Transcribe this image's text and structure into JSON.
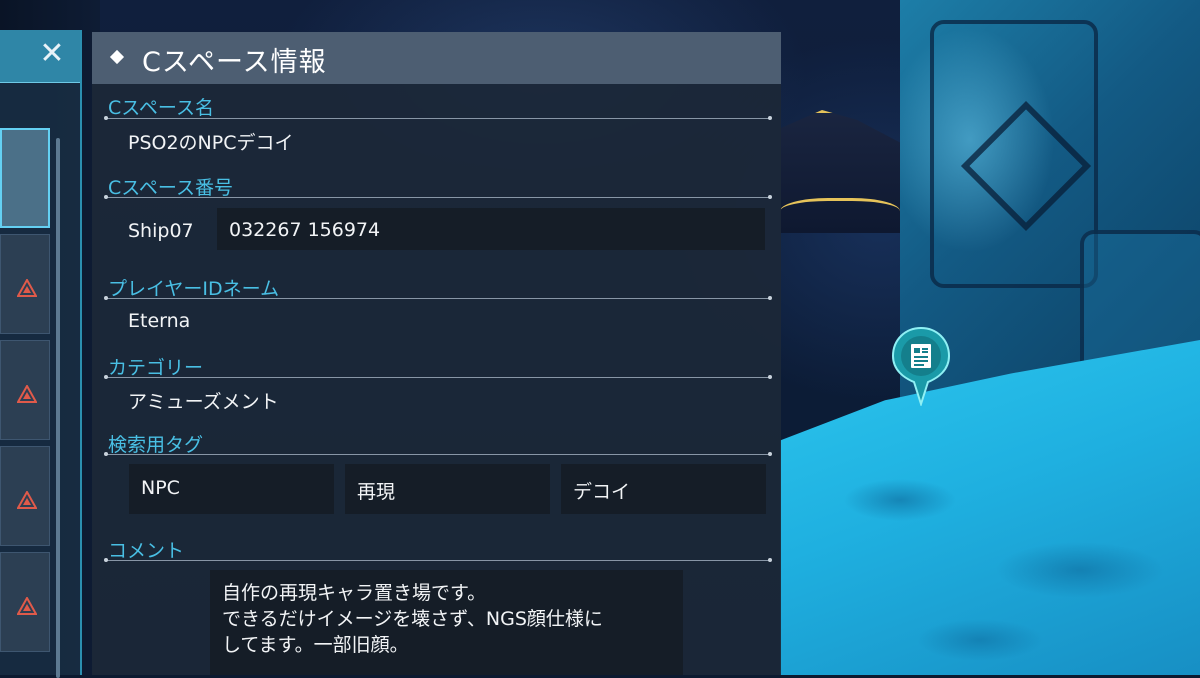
{
  "panel": {
    "title": "Cスペース情報",
    "sections": {
      "name": {
        "label": "Cスペース名",
        "value": "PSO2のNPCデコイ"
      },
      "number": {
        "label": "Cスペース番号",
        "ship": "Ship07",
        "value": "032267  156974"
      },
      "player": {
        "label": "プレイヤーIDネーム",
        "value": "Eterna"
      },
      "category": {
        "label": "カテゴリー",
        "value": "アミューズメント"
      },
      "tags": {
        "label": "検索用タグ",
        "items": [
          "NPC",
          "再現",
          "デコイ"
        ]
      },
      "comment": {
        "label": "コメント",
        "lines": [
          "自作の再現キャラ置き場です。",
          "できるだけイメージを壊さず、NGS顔仕様に",
          "してます。一部旧顔。"
        ]
      }
    }
  },
  "side_list": {
    "close_symbol": "✕",
    "items": [
      {
        "selected": true,
        "icon": "none"
      },
      {
        "selected": false,
        "icon": "warning-icon"
      },
      {
        "selected": false,
        "icon": "warning-icon"
      },
      {
        "selected": false,
        "icon": "warning-icon"
      },
      {
        "selected": false,
        "icon": "warning-icon"
      }
    ]
  },
  "marker": {
    "icon": "document-marker-icon"
  },
  "colors": {
    "accent": "#49bfe4",
    "panel_bg": "#1c2838",
    "title_bar": "#4d5e72",
    "field_bg": "#151d27",
    "warning": "#e05a4a"
  }
}
